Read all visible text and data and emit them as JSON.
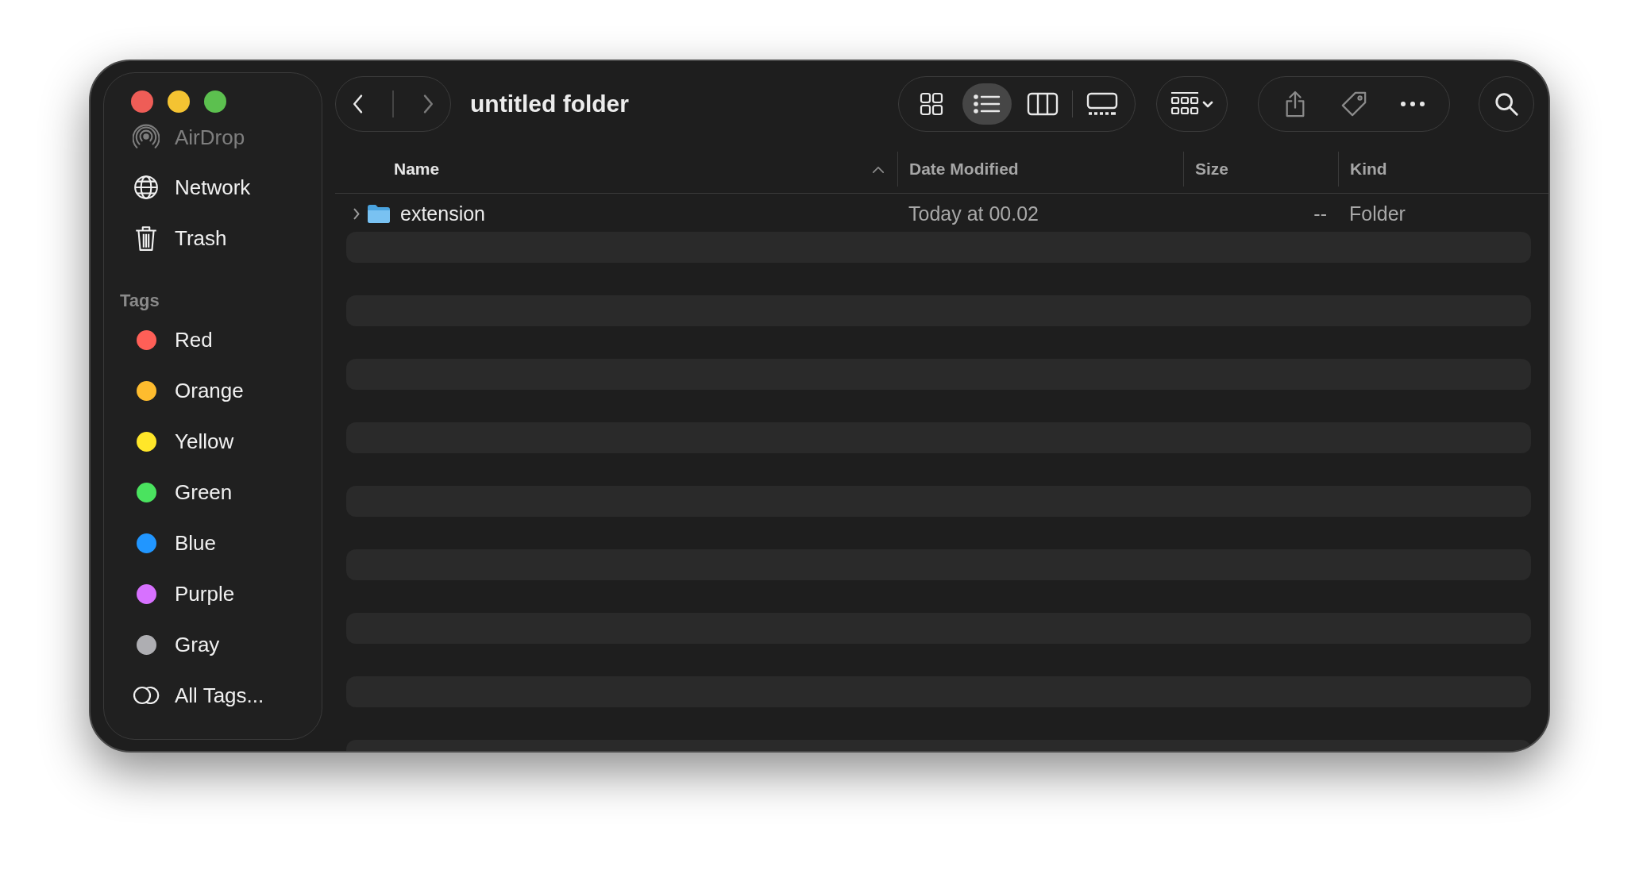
{
  "window": {
    "title": "untitled folder"
  },
  "navigation": {
    "back": {
      "disabled": false
    },
    "forward": {
      "disabled": true
    }
  },
  "view_buttons": [
    {
      "kind": "icons",
      "selected": false
    },
    {
      "kind": "list",
      "selected": true
    },
    {
      "kind": "columns",
      "selected": false
    },
    {
      "kind": "gallery",
      "selected": false
    }
  ],
  "sidebar": {
    "items": [
      {
        "label": "AirDrop",
        "kind": "airdrop",
        "dimmed": true
      },
      {
        "label": "Network",
        "kind": "network",
        "dimmed": false
      },
      {
        "label": "Trash",
        "kind": "trash",
        "dimmed": false
      }
    ],
    "tags_heading": "Tags",
    "tags": [
      {
        "label": "Red",
        "color": "#ff5f57"
      },
      {
        "label": "Orange",
        "color": "#febc2e"
      },
      {
        "label": "Yellow",
        "color": "#ffe629"
      },
      {
        "label": "Green",
        "color": "#4ae35f"
      },
      {
        "label": "Blue",
        "color": "#2196ff"
      },
      {
        "label": "Purple",
        "color": "#d771ff"
      },
      {
        "label": "Gray",
        "color": "#aeaeb2"
      }
    ],
    "all_tags": "All Tags..."
  },
  "columns": [
    {
      "label": "Name",
      "sorted": true
    },
    {
      "label": "Date Modified",
      "sorted": false
    },
    {
      "label": "Size",
      "sorted": false
    },
    {
      "label": "Kind",
      "sorted": false
    }
  ],
  "rows": [
    {
      "name": "extension",
      "expanded": false,
      "date_modified": "Today at 00.02",
      "size": "--",
      "kind_text": "Folder"
    }
  ]
}
